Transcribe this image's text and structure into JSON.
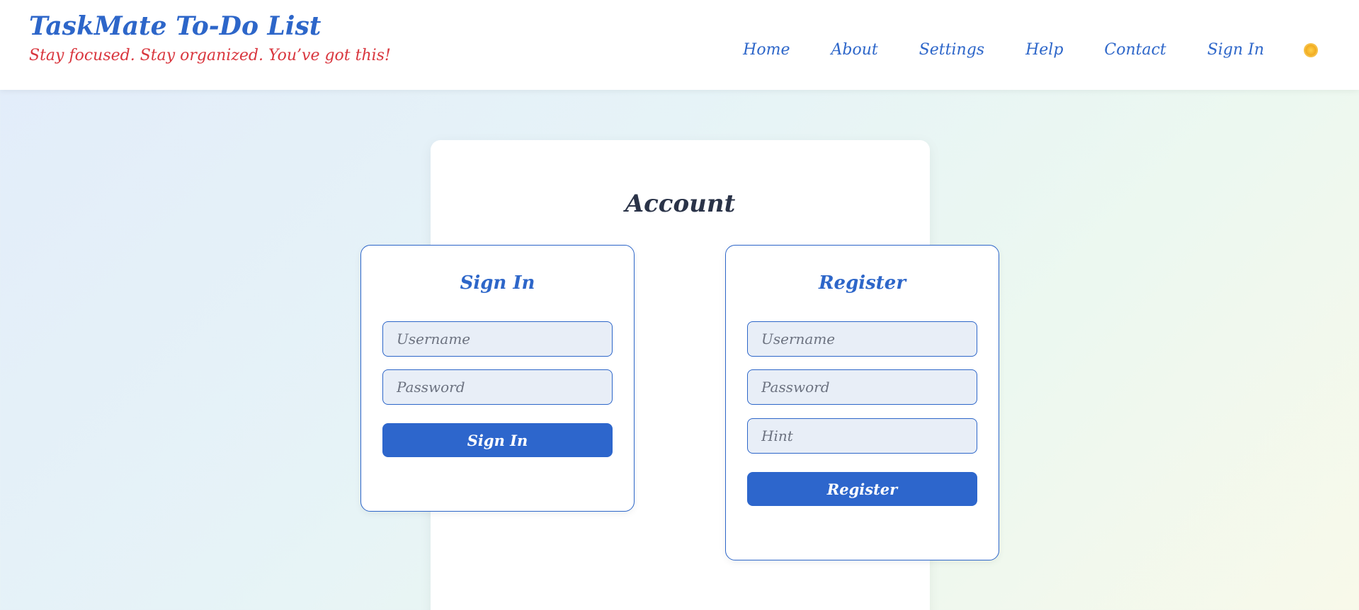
{
  "header": {
    "title": "TaskMate To-Do List",
    "tagline": "Stay focused. Stay organized. You’ve got this!",
    "nav": [
      "Home",
      "About",
      "Settings",
      "Help",
      "Contact",
      "Sign In"
    ],
    "theme_icon": "sun-icon"
  },
  "account": {
    "title": "Account",
    "signin": {
      "title": "Sign In",
      "username_placeholder": "Username",
      "password_placeholder": "Password",
      "button": "Sign In"
    },
    "register": {
      "title": "Register",
      "username_placeholder": "Username",
      "password_placeholder": "Password",
      "hint_placeholder": "Hint",
      "button": "Register"
    }
  },
  "colors": {
    "brand": "#2d66c9",
    "tagline": "#d9363e",
    "heading": "#2a3348",
    "input_bg": "#e8eef7"
  }
}
